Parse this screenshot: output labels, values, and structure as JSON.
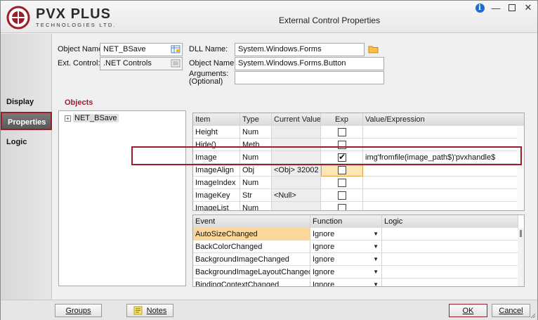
{
  "window": {
    "title": "External Control Properties",
    "brand_main": "PVX PLUS",
    "brand_sub": "TECHNOLOGIES LTD."
  },
  "left_tabs": [
    {
      "label": "Display",
      "active": false
    },
    {
      "label": "Properties",
      "active": true
    },
    {
      "label": "Logic",
      "active": false
    }
  ],
  "form": {
    "object_name_label": "Object Name:",
    "object_name_value": "NET_BSave",
    "ext_control_label": "Ext. Control:",
    "ext_control_value": ".NET Controls",
    "dll_name_label": "DLL Name:",
    "dll_name_value": "System.Windows.Forms",
    "object_name2_label": "Object Name:",
    "object_name2_value": "System.Windows.Forms.Button",
    "arguments_label_1": "Arguments:",
    "arguments_label_2": "(Optional)",
    "arguments_value": ""
  },
  "objects": {
    "title": "Objects",
    "tree": [
      {
        "label": "NET_BSave"
      }
    ]
  },
  "properties_grid": {
    "headers": [
      "Item",
      "Type",
      "Current Value",
      "Exp",
      "Value/Expression"
    ],
    "rows": [
      {
        "item": "Height",
        "type": "Num",
        "current": "",
        "exp": false,
        "value": ""
      },
      {
        "item": "Hide()",
        "type": "Meth",
        "current": "",
        "exp": false,
        "value": ""
      },
      {
        "item": "Image",
        "type": "Num",
        "current": "",
        "exp": true,
        "value": "img'fromfile(image_path$)'pvxhandle$"
      },
      {
        "item": "ImageAlign",
        "type": "Obj",
        "current": "<Obj> 32002",
        "exp": false,
        "value": ""
      },
      {
        "item": "ImageIndex",
        "type": "Num",
        "current": "",
        "exp": false,
        "value": ""
      },
      {
        "item": "ImageKey",
        "type": "Str",
        "current": "<Null>",
        "exp": false,
        "value": ""
      },
      {
        "item": "ImageList",
        "type": "Num",
        "current": "",
        "exp": false,
        "value": ""
      }
    ]
  },
  "events_grid": {
    "headers": [
      "Event",
      "Function",
      "Logic"
    ],
    "rows": [
      {
        "event": "AutoSizeChanged",
        "function": "Ignore",
        "logic": "",
        "selected": true
      },
      {
        "event": "BackColorChanged",
        "function": "Ignore",
        "logic": "",
        "selected": false
      },
      {
        "event": "BackgroundImageChanged",
        "function": "Ignore",
        "logic": "",
        "selected": false
      },
      {
        "event": "BackgroundImageLayoutChanged",
        "function": "Ignore",
        "logic": "",
        "selected": false
      },
      {
        "event": "BindingContextChanged",
        "function": "Ignore",
        "logic": "",
        "selected": false
      }
    ]
  },
  "bottom": {
    "groups_label": "Groups",
    "notes_label": "Notes",
    "ok_label": "OK",
    "cancel_label": "Cancel"
  },
  "colors": {
    "accent": "#9b1f2a",
    "selection": "#fbd79b"
  }
}
